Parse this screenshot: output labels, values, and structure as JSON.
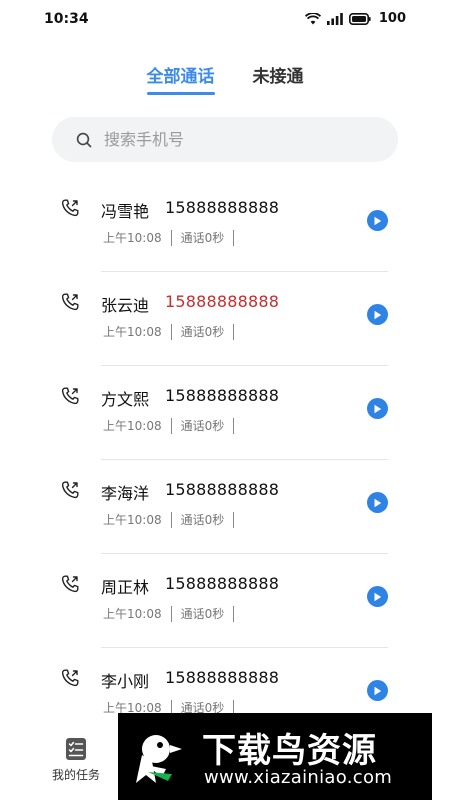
{
  "status_bar": {
    "time": "10:34",
    "battery": "100"
  },
  "tabs": [
    {
      "label": "全部通话",
      "active": true
    },
    {
      "label": "未接通",
      "active": false
    }
  ],
  "search": {
    "placeholder": "搜索手机号",
    "value": ""
  },
  "calls": [
    {
      "name": "冯雪艳",
      "number": "15888888888",
      "time": "上午10:08",
      "duration": "通话0秒",
      "missed": false
    },
    {
      "name": "张云迪",
      "number": "15888888888",
      "time": "上午10:08",
      "duration": "通话0秒",
      "missed": true
    },
    {
      "name": "方文熙",
      "number": "15888888888",
      "time": "上午10:08",
      "duration": "通话0秒",
      "missed": false
    },
    {
      "name": "李海洋",
      "number": "15888888888",
      "time": "上午10:08",
      "duration": "通话0秒",
      "missed": false
    },
    {
      "name": "周正林",
      "number": "15888888888",
      "time": "上午10:08",
      "duration": "通话0秒",
      "missed": false
    },
    {
      "name": "李小刚",
      "number": "15888888888",
      "time": "上午10:08",
      "duration": "通话0秒",
      "missed": false
    }
  ],
  "bottom_nav": {
    "my_tasks_label": "我的任务"
  },
  "watermark": {
    "title": "下载鸟资源",
    "url": "www.xiazainiao.com"
  },
  "colors": {
    "accent": "#3d8be8",
    "missed": "#cc2b2b",
    "play": "#2f83e4"
  },
  "icons": {
    "call": "phone-outgoing-icon",
    "play": "play-icon",
    "search": "search-icon",
    "task": "task-list-icon"
  }
}
